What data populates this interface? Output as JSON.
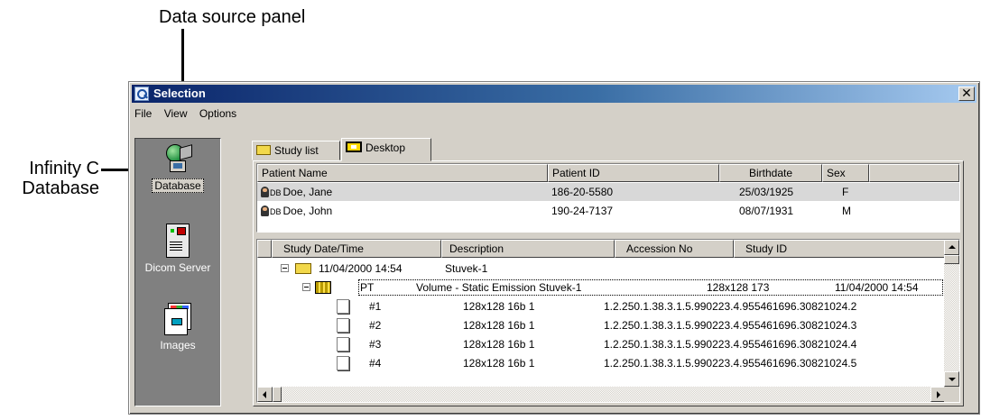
{
  "annotations": {
    "data_source_panel": "Data source panel",
    "infinity_database": "Infinity C\nDatabase"
  },
  "window": {
    "title": "Selection",
    "close": "✕"
  },
  "menu": [
    "File",
    "View",
    "Options"
  ],
  "sidebar": {
    "items": [
      {
        "label": "Database",
        "icon": "database-icon",
        "selected": true
      },
      {
        "label": "Dicom Server",
        "icon": "dicom-server-icon",
        "selected": false
      },
      {
        "label": "Images",
        "icon": "images-icon",
        "selected": false
      }
    ]
  },
  "tabs": [
    {
      "label": "Study list",
      "icon": "folder-icon",
      "active": false
    },
    {
      "label": "Desktop",
      "icon": "desktop-icon",
      "active": true
    }
  ],
  "patients": {
    "columns": [
      "Patient Name",
      "Patient ID",
      "Birthdate",
      "Sex"
    ],
    "rows": [
      {
        "tag": "DB",
        "name": "Doe, Jane",
        "id": "186-20-5580",
        "birthdate": "25/03/1925",
        "sex": "F",
        "selected": true
      },
      {
        "tag": "DB",
        "name": "Doe, John",
        "id": "190-24-7137",
        "birthdate": "08/07/1931",
        "sex": "M",
        "selected": false
      }
    ]
  },
  "studies": {
    "columns": [
      "Study Date/Time",
      "Description",
      "Accession No",
      "Study ID"
    ],
    "study": {
      "datetime": "11/04/2000 14:54",
      "description": "Stuvek-1"
    },
    "series": {
      "modality": "PT",
      "description": "Volume - Static Emission Stuvek-1",
      "matrix": "128x128 173",
      "datetime": "11/04/2000 14:54"
    },
    "images": [
      {
        "num": "#1",
        "format": "128x128 16b 1",
        "uid": "1.2.250.1.38.3.1.5.990223.4.955461696.30821024.2"
      },
      {
        "num": "#2",
        "format": "128x128 16b 1",
        "uid": "1.2.250.1.38.3.1.5.990223.4.955461696.30821024.3"
      },
      {
        "num": "#3",
        "format": "128x128 16b 1",
        "uid": "1.2.250.1.38.3.1.5.990223.4.955461696.30821024.4"
      },
      {
        "num": "#4",
        "format": "128x128 16b 1",
        "uid": "1.2.250.1.38.3.1.5.990223.4.955461696.30821024.5"
      }
    ]
  }
}
